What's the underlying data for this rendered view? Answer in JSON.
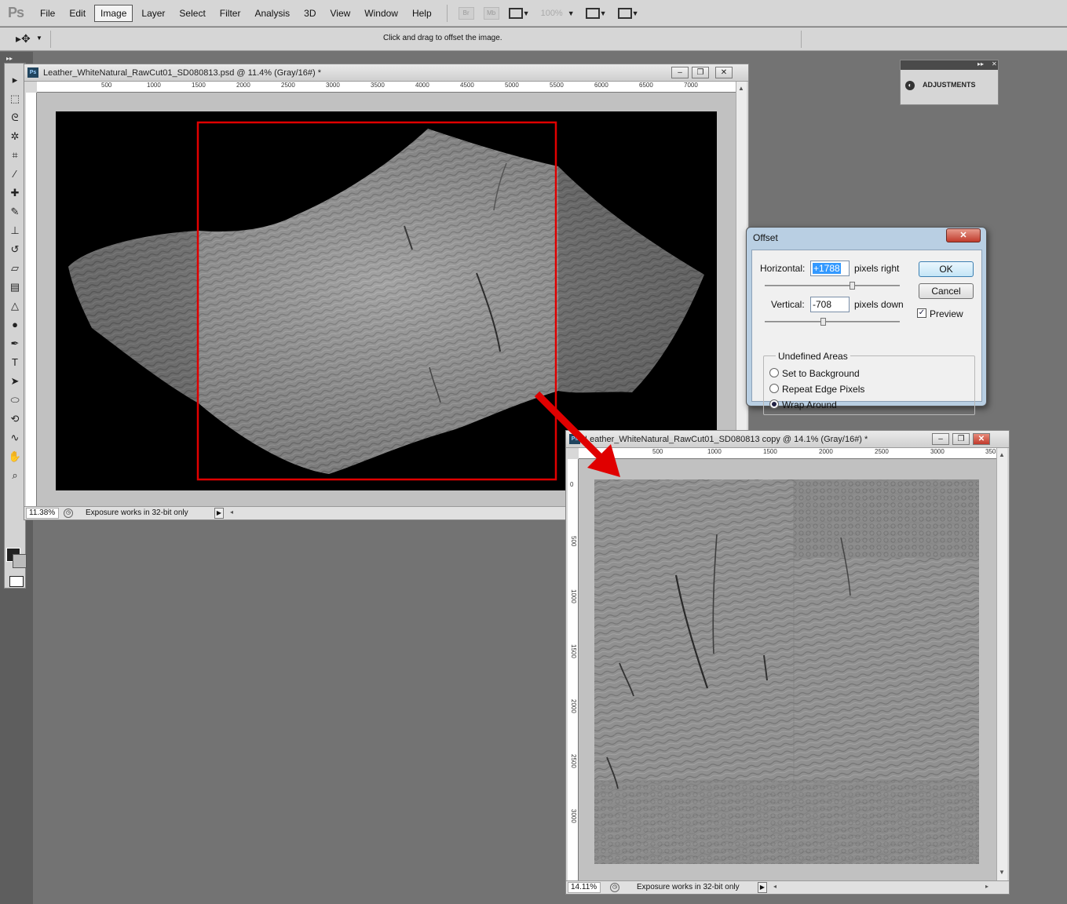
{
  "app": {
    "logo": "Ps"
  },
  "menu": {
    "items": [
      "File",
      "Edit",
      "Image",
      "Layer",
      "Select",
      "Filter",
      "Analysis",
      "3D",
      "View",
      "Window",
      "Help"
    ],
    "active": "Image",
    "bridge_label": "Br",
    "minibridge_label": "Mb",
    "zoom_label": "100%"
  },
  "options": {
    "hint": "Click and drag to offset the image."
  },
  "doc1": {
    "title": "Leather_WhiteNatural_RawCut01_SD080813.psd @ 11.4% (Gray/16#) *",
    "ruler_ticks": [
      "500",
      "1000",
      "1500",
      "2000",
      "2500",
      "3000",
      "3500",
      "4000",
      "4500",
      "5000",
      "5500",
      "6000",
      "6500",
      "7000"
    ],
    "zoom": "11.38%",
    "status": "Exposure works in 32-bit only"
  },
  "doc2": {
    "title": "Leather_WhiteNatural_RawCut01_SD080813 copy @ 14.1% (Gray/16#) *",
    "ruler_ticks": [
      "500",
      "1000",
      "1500",
      "2000",
      "2500",
      "3000",
      "350"
    ],
    "vruler_ticks": [
      "0",
      "500",
      "1000",
      "1500",
      "2000",
      "2500",
      "3000"
    ],
    "zoom": "14.11%",
    "status": "Exposure works in 32-bit only"
  },
  "adjustments": {
    "label": "ADJUSTMENTS"
  },
  "dialog": {
    "title": "Offset",
    "horizontal_label": "Horizontal:",
    "horizontal_value": "+1788",
    "horizontal_unit": "pixels right",
    "vertical_label": "Vertical:",
    "vertical_value": "-708",
    "vertical_unit": "pixels down",
    "ok": "OK",
    "cancel": "Cancel",
    "preview_label": "Preview",
    "preview_checked": true,
    "undefined_title": "Undefined Areas",
    "options": [
      "Set to Background",
      "Repeat Edge Pixels",
      "Wrap Around"
    ],
    "selected_option": "Wrap Around"
  },
  "colors": {
    "highlight_frame": "#e00000",
    "arrow": "#e00000"
  }
}
